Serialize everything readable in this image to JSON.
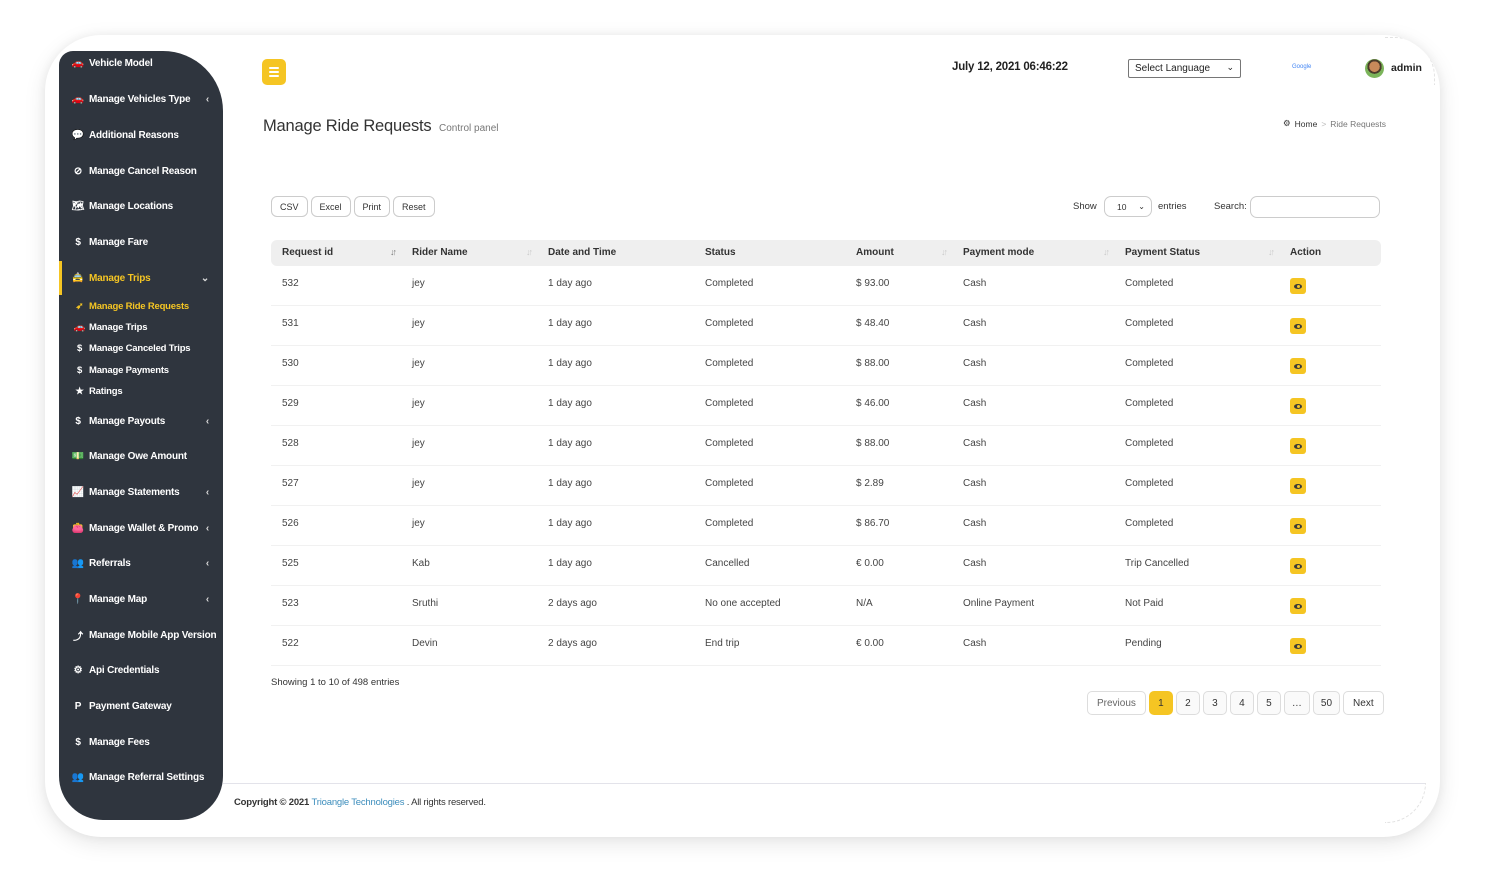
{
  "sidebar": {
    "items": [
      {
        "label": "Vehicle Model",
        "icon": "car-icon",
        "glyph": "🚗",
        "chevron": false
      },
      {
        "label": "Manage Vehicles Type",
        "icon": "car-icon",
        "glyph": "🚗",
        "chevron": true
      },
      {
        "label": "Additional Reasons",
        "icon": "comment-icon",
        "glyph": "💬",
        "chevron": false
      },
      {
        "label": "Manage Cancel Reason",
        "icon": "ban-icon",
        "glyph": "⊘",
        "chevron": false
      },
      {
        "label": "Manage Locations",
        "icon": "map-icon",
        "glyph": "🗺",
        "chevron": false
      },
      {
        "label": "Manage Fare",
        "icon": "dollar-icon",
        "glyph": "$",
        "chevron": false
      },
      {
        "label": "Manage Trips",
        "icon": "taxi-icon",
        "glyph": "🚖",
        "chevron": true,
        "active": true
      },
      {
        "label": "Manage Payouts",
        "icon": "dollar-icon",
        "glyph": "$",
        "chevron": true
      },
      {
        "label": "Manage Owe Amount",
        "icon": "money-icon",
        "glyph": "💵",
        "chevron": false
      },
      {
        "label": "Manage Statements",
        "icon": "area-chart-icon",
        "glyph": "📈",
        "chevron": true
      },
      {
        "label": "Manage Wallet & Promo",
        "icon": "wallet-icon",
        "glyph": "👛",
        "chevron": true
      },
      {
        "label": "Referrals",
        "icon": "users-icon",
        "glyph": "👥",
        "chevron": true
      },
      {
        "label": "Manage Map",
        "icon": "map-marker-icon",
        "glyph": "📍",
        "chevron": true
      },
      {
        "label": "Manage Mobile App Version",
        "icon": "upload-icon",
        "glyph": "⤴",
        "chevron": false
      },
      {
        "label": "Api Credentials",
        "icon": "gear-icon",
        "glyph": "⚙",
        "chevron": false
      },
      {
        "label": "Payment Gateway",
        "icon": "paypal-icon",
        "glyph": "P",
        "chevron": false
      },
      {
        "label": "Manage Fees",
        "icon": "dollar-icon",
        "glyph": "$",
        "chevron": false
      },
      {
        "label": "Manage Referral Settings",
        "icon": "users-icon",
        "glyph": "👥",
        "chevron": false
      }
    ],
    "sub_items": [
      {
        "label": "Manage Ride Requests",
        "icon": "paper-plane-icon",
        "glyph": "➶",
        "active": true
      },
      {
        "label": "Manage Trips",
        "icon": "car-icon",
        "glyph": "🚗"
      },
      {
        "label": "Manage Canceled Trips",
        "icon": "money-cancel-icon",
        "glyph": "$"
      },
      {
        "label": "Manage Payments",
        "icon": "dollar-icon",
        "glyph": "$"
      },
      {
        "label": "Ratings",
        "icon": "star-icon",
        "glyph": "★"
      }
    ],
    "chevron_left": "‹",
    "chevron_down": "⌄"
  },
  "header": {
    "datetime": "July 12, 2021 06:46:22",
    "language_select": "Select Language",
    "google_label": "Google",
    "user": "admin"
  },
  "page": {
    "title": "Manage Ride Requests",
    "subtitle": "Control panel",
    "breadcrumb": {
      "home": "Home",
      "separator": ">",
      "current": "Ride Requests"
    }
  },
  "toolbar": {
    "buttons": [
      "CSV",
      "Excel",
      "Print",
      "Reset"
    ],
    "show_label": "Show",
    "page_length": "10",
    "entries_label": "entries",
    "search_label": "Search:",
    "search_value": ""
  },
  "table": {
    "columns": [
      "Request id",
      "Rider Name",
      "Date and Time",
      "Status",
      "Amount",
      "Payment mode",
      "Payment Status",
      "Action"
    ],
    "rows": [
      {
        "id": "532",
        "rider": "jey",
        "date": "1 day ago",
        "status": "Completed",
        "amount": "$ 93.00",
        "mode": "Cash",
        "pay_status": "Completed"
      },
      {
        "id": "531",
        "rider": "jey",
        "date": "1 day ago",
        "status": "Completed",
        "amount": "$ 48.40",
        "mode": "Cash",
        "pay_status": "Completed"
      },
      {
        "id": "530",
        "rider": "jey",
        "date": "1 day ago",
        "status": "Completed",
        "amount": "$ 88.00",
        "mode": "Cash",
        "pay_status": "Completed"
      },
      {
        "id": "529",
        "rider": "jey",
        "date": "1 day ago",
        "status": "Completed",
        "amount": "$ 46.00",
        "mode": "Cash",
        "pay_status": "Completed"
      },
      {
        "id": "528",
        "rider": "jey",
        "date": "1 day ago",
        "status": "Completed",
        "amount": "$ 88.00",
        "mode": "Cash",
        "pay_status": "Completed"
      },
      {
        "id": "527",
        "rider": "jey",
        "date": "1 day ago",
        "status": "Completed",
        "amount": "$ 2.89",
        "mode": "Cash",
        "pay_status": "Completed"
      },
      {
        "id": "526",
        "rider": "jey",
        "date": "1 day ago",
        "status": "Completed",
        "amount": "$ 86.70",
        "mode": "Cash",
        "pay_status": "Completed"
      },
      {
        "id": "525",
        "rider": "Kab",
        "date": "1 day ago",
        "status": "Cancelled",
        "amount": "€ 0.00",
        "mode": "Cash",
        "pay_status": "Trip Cancelled"
      },
      {
        "id": "523",
        "rider": "Sruthi",
        "date": "2 days ago",
        "status": "No one accepted",
        "amount": "N/A",
        "mode": "Online Payment",
        "pay_status": "Not Paid"
      },
      {
        "id": "522",
        "rider": "Devin",
        "date": "2 days ago",
        "status": "End trip",
        "amount": "€ 0.00",
        "mode": "Cash",
        "pay_status": "Pending"
      }
    ],
    "info": "Showing 1 to 10 of 498 entries"
  },
  "pagination": {
    "previous": "Previous",
    "pages": [
      "1",
      "2",
      "3",
      "4",
      "5",
      "…",
      "50"
    ],
    "current": "1",
    "next": "Next"
  },
  "footer": {
    "prefix": "Copyright © 2021",
    "brand": "Trioangle Technologies",
    "suffix": ". All rights reserved."
  },
  "colors": {
    "accent": "#f5c523",
    "sidebar_bg": "#2f353e",
    "link": "#3c8dbc"
  }
}
